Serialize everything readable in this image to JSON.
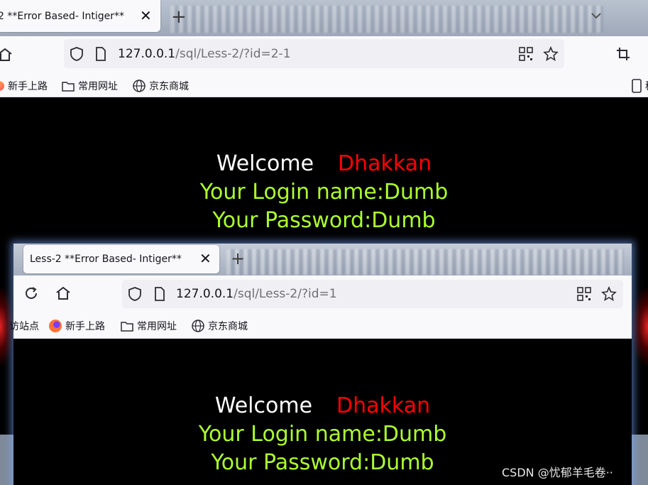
{
  "back_window": {
    "tab_title": "2 **Error Based- Intiger**",
    "url_host": "127.0.0.1",
    "url_path": "/sql/Less-2/?id=2-1",
    "bookmarks": [
      {
        "label": "新手上路",
        "icon": "firefox-icon"
      },
      {
        "label": "常用网址",
        "icon": "folder-icon"
      },
      {
        "label": "京东商城",
        "icon": "globe-icon"
      }
    ],
    "right_bookmark_fragment": "移",
    "page": {
      "welcome": "Welcome",
      "name": "Dhakkan",
      "login_line": "Your Login name:Dumb",
      "password_line": "Your Password:Dumb"
    }
  },
  "front_window": {
    "tab_title": "Less-2 **Error Based- Intiger**",
    "url_host": "127.0.0.1",
    "url_path": "/sql/Less-2/?id=1",
    "bookmarks": [
      {
        "label": "访站点",
        "icon": "none"
      },
      {
        "label": "新手上路",
        "icon": "firefox-icon"
      },
      {
        "label": "常用网址",
        "icon": "folder-icon"
      },
      {
        "label": "京东商城",
        "icon": "globe-icon"
      }
    ],
    "page": {
      "welcome": "Welcome",
      "name": "Dhakkan",
      "login_line": "Your Login name:Dumb",
      "password_line": "Your Password:Dumb"
    }
  },
  "watermark": "CSDN @忧郁羊毛卷··",
  "colors": {
    "welcome": "#ffffff",
    "name": "#ff0000",
    "credentials": "#adff2f",
    "page_background": "#000000"
  }
}
